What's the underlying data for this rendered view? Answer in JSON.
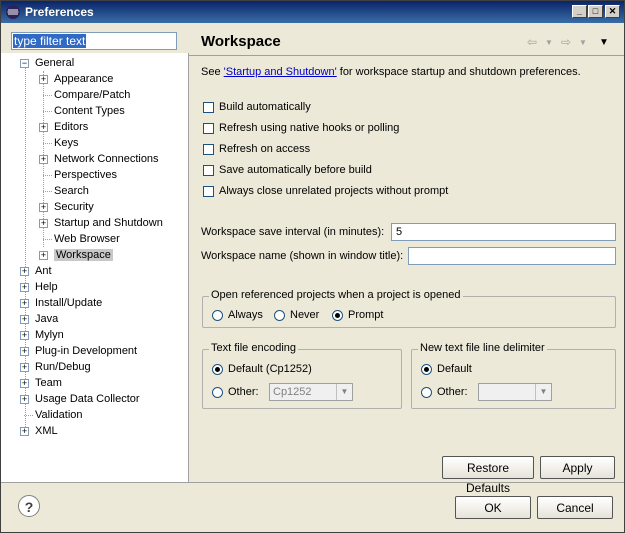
{
  "window": {
    "title": "Preferences"
  },
  "filter": {
    "value": "type filter text"
  },
  "tree": {
    "general": "General",
    "general_children": [
      "Appearance",
      "Compare/Patch",
      "Content Types",
      "Editors",
      "Keys",
      "Network Connections",
      "Perspectives",
      "Search",
      "Security",
      "Startup and Shutdown",
      "Web Browser",
      "Workspace"
    ],
    "top": [
      "Ant",
      "Help",
      "Install/Update",
      "Java",
      "Mylyn",
      "Plug-in Development",
      "Run/Debug",
      "Team",
      "Usage Data Collector",
      "Validation",
      "XML"
    ]
  },
  "page": {
    "title": "Workspace",
    "desc_pre": "See ",
    "desc_link": "'Startup and Shutdown'",
    "desc_post": " for workspace startup and shutdown preferences.",
    "checks": [
      "Build automatically",
      "Refresh using native hooks or polling",
      "Refresh on access",
      "Save automatically before build",
      "Always close unrelated projects without prompt"
    ],
    "save_interval_label": "Workspace save interval (in minutes):",
    "save_interval_value": "5",
    "name_label": "Workspace name (shown in window title):",
    "name_value": "",
    "open_group": {
      "title": "Open referenced projects when a project is opened",
      "options": [
        "Always",
        "Never",
        "Prompt"
      ],
      "selected": "Prompt"
    },
    "encoding_group": {
      "title": "Text file encoding",
      "default": "Default (Cp1252)",
      "other": "Other:",
      "other_value": "Cp1252",
      "selected": "Default"
    },
    "delim_group": {
      "title": "New text file line delimiter",
      "default": "Default",
      "other": "Other:",
      "selected": "Default"
    },
    "restore_defaults": "Restore Defaults",
    "apply": "Apply"
  },
  "footer": {
    "help": "?",
    "ok": "OK",
    "cancel": "Cancel"
  }
}
